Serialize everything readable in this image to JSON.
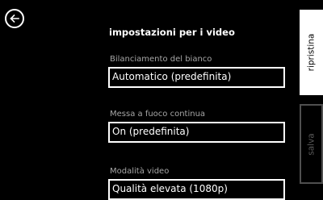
{
  "header": {
    "back_icon": "back-arrow-icon",
    "title": "impostazioni per i video"
  },
  "settings": [
    {
      "label": "Bilanciamento del bianco",
      "value": "Automatico (predefinita)"
    },
    {
      "label": "Messa a fuoco continua",
      "value": "On (predefinita)"
    },
    {
      "label": "Modalità video",
      "value": "Qualità elevata (1080p)"
    }
  ],
  "appbar": {
    "reset_label": "ripristina",
    "save_label": "salva"
  },
  "colors": {
    "background": "#000000",
    "foreground": "#ffffff",
    "label": "#a6a6a6",
    "disabled": "#5a5a5a"
  }
}
